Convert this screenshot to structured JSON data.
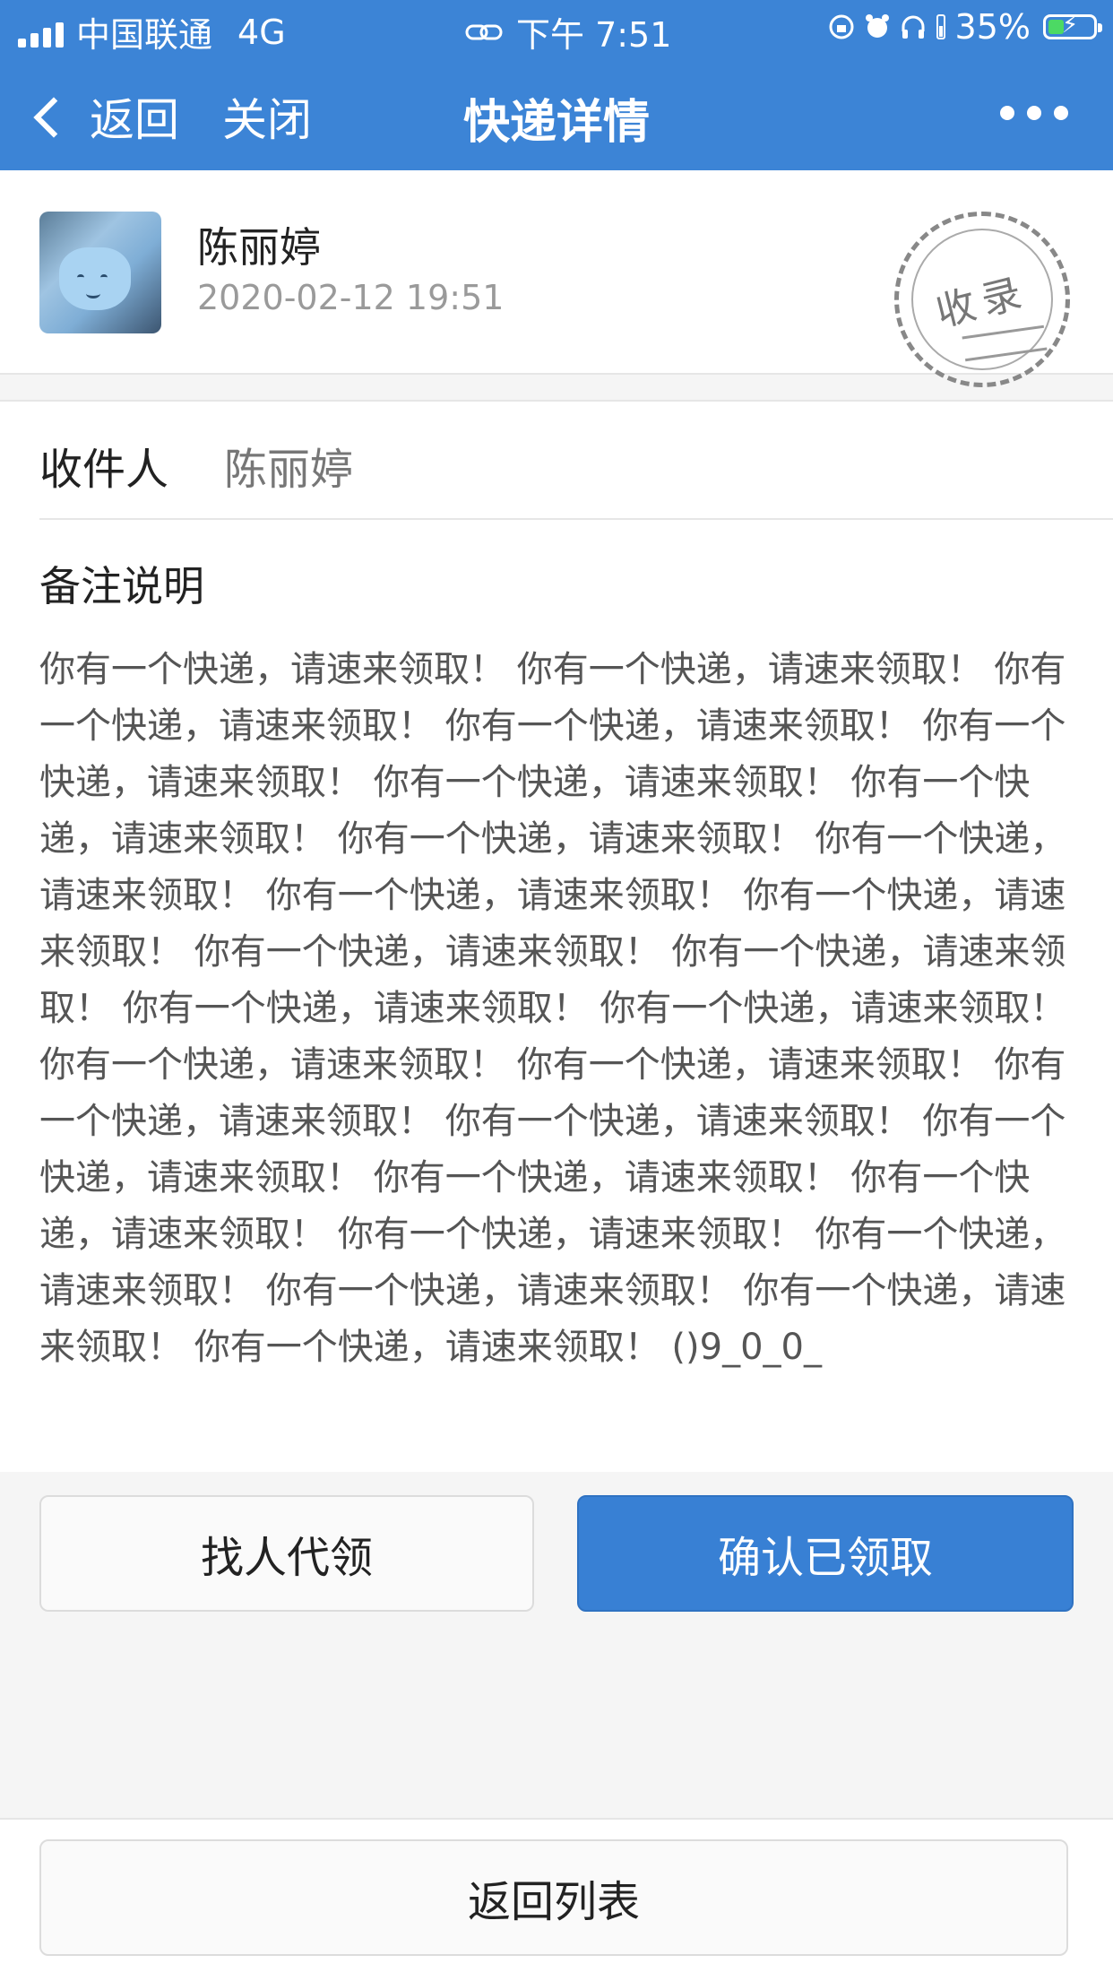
{
  "status_bar": {
    "carrier": "中国联通",
    "network": "4G",
    "time": "下午 7:51",
    "battery": "35%"
  },
  "nav": {
    "back_label": "返回",
    "close_label": "关闭",
    "title": "快递详情"
  },
  "header": {
    "sender_name": "陈丽婷",
    "timestamp": "2020-02-12 19:51",
    "stamp_text": "收录"
  },
  "recipient": {
    "label": "收件人",
    "value": "陈丽婷"
  },
  "remark": {
    "title": "备注说明",
    "body": "你有一个快递，请速来领取！ 你有一个快递，请速来领取！ 你有一个快递，请速来领取！ 你有一个快递，请速来领取！ 你有一个快递，请速来领取！ 你有一个快递，请速来领取！ 你有一个快递，请速来领取！ 你有一个快递，请速来领取！ 你有一个快递，请速来领取！ 你有一个快递，请速来领取！ 你有一个快递，请速来领取！ 你有一个快递，请速来领取！ 你有一个快递，请速来领取！ 你有一个快递，请速来领取！ 你有一个快递，请速来领取！ 你有一个快递，请速来领取！ 你有一个快递，请速来领取！ 你有一个快递，请速来领取！ 你有一个快递，请速来领取！ 你有一个快递，请速来领取！ 你有一个快递，请速来领取！ 你有一个快递，请速来领取！ 你有一个快递，请速来领取！ 你有一个快递，请速来领取！ 你有一个快递，请速来领取！ 你有一个快递，请速来领取！ 你有一个快递，请速来领取！ ()9_0_0_"
  },
  "actions": {
    "proxy_label": "找人代领",
    "confirm_label": "确认已领取",
    "back_to_list_label": "返回列表"
  },
  "colors": {
    "brand": "#3c84d6",
    "confirm": "#3880d4",
    "battery_charge": "#4cd964"
  }
}
